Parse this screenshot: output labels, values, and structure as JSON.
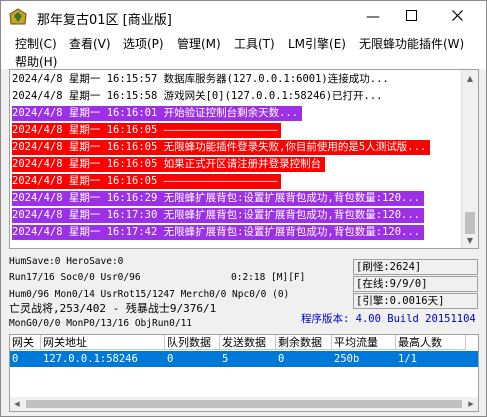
{
  "window": {
    "title": "那年复古01区 [商业版]",
    "min_glyph": "—",
    "max_glyph": "☐",
    "close_glyph": "✕"
  },
  "menu": {
    "items": [
      {
        "label": "控制(C)"
      },
      {
        "label": "查看(V)"
      },
      {
        "label": "选项(P)"
      },
      {
        "label": "管理(M)"
      },
      {
        "label": "工具(T)"
      },
      {
        "label": "LM引擎(E)"
      },
      {
        "label": "无限蜂功能插件(W)"
      },
      {
        "label": "帮助(H)"
      }
    ]
  },
  "log": {
    "lines": [
      {
        "text": "2024/4/8 星期一 16:15:57 数据库服务器(127.0.0.1:6001)连接成功...",
        "style": "normal"
      },
      {
        "text": "2024/4/8 星期一 16:15:58 游戏网关[0](127.0.0.1:58246)已打开...",
        "style": "normal"
      },
      {
        "text": "2024/4/8 星期一 16:16:01 开始验证控制台剩余天数...",
        "style": "purple"
      },
      {
        "text": "2024/4/8 星期一 16:16:05 ——————————————————",
        "style": "red"
      },
      {
        "text": "2024/4/8 星期一 16:16:05 无限蜂功能插件登录失败,你目前使用的是5人测试版...",
        "style": "red"
      },
      {
        "text": "2024/4/8 星期一 16:16:05 如果正式开区请注册并登录控制台",
        "style": "red"
      },
      {
        "text": "2024/4/8 星期一 16:16:05 ——————————————————",
        "style": "red"
      },
      {
        "text": "2024/4/8 星期一 16:16:29 无限蜂扩展背包:设置扩展背包成功,背包数量:120...",
        "style": "purple"
      },
      {
        "text": "2024/4/8 星期一 16:17:30 无限蜂扩展背包:设置扩展背包成功,背包数量:120...",
        "style": "purple"
      },
      {
        "text": "2024/4/8 星期一 16:17:42 无限蜂扩展背包:设置扩展背包成功,背包数量:120...",
        "style": "purple"
      }
    ]
  },
  "status": {
    "humsave": "HumSave:0 HeroSave:0",
    "run": "Run17/16 Soc0/0 Usr0/96",
    "timer": "0:2:18 [M][F]",
    "hum": "Hum0/96 Mon0/14 UsrRot15/1247 Merch0/0 Npc0/0 (0)",
    "battle": "亡灵战将,253/402 - 残暴战士9/376/1",
    "mon": "MonG0/0/0 MonP0/13/16 ObjRun0/11",
    "refresh_panel": "[刷怪:2624]",
    "online_panel": "[在线:9/9/0]",
    "ratio_panel": "[引擎:0.0016天]",
    "version": "程序版本: 4.00 Build 20151104"
  },
  "table": {
    "headers": [
      "网关",
      "网关地址",
      "队列数据",
      "发送数据",
      "剩余数据",
      "平均流量",
      "最高人数"
    ],
    "rows": [
      [
        "0",
        "127.0.0.1:58246",
        "0",
        "5",
        "0",
        "250b",
        "1/1"
      ]
    ]
  },
  "colors": {
    "purple_row": "#9b30e6",
    "red_row": "#ff0000",
    "selection": "#0078d7",
    "version_text": "#0000cc"
  }
}
